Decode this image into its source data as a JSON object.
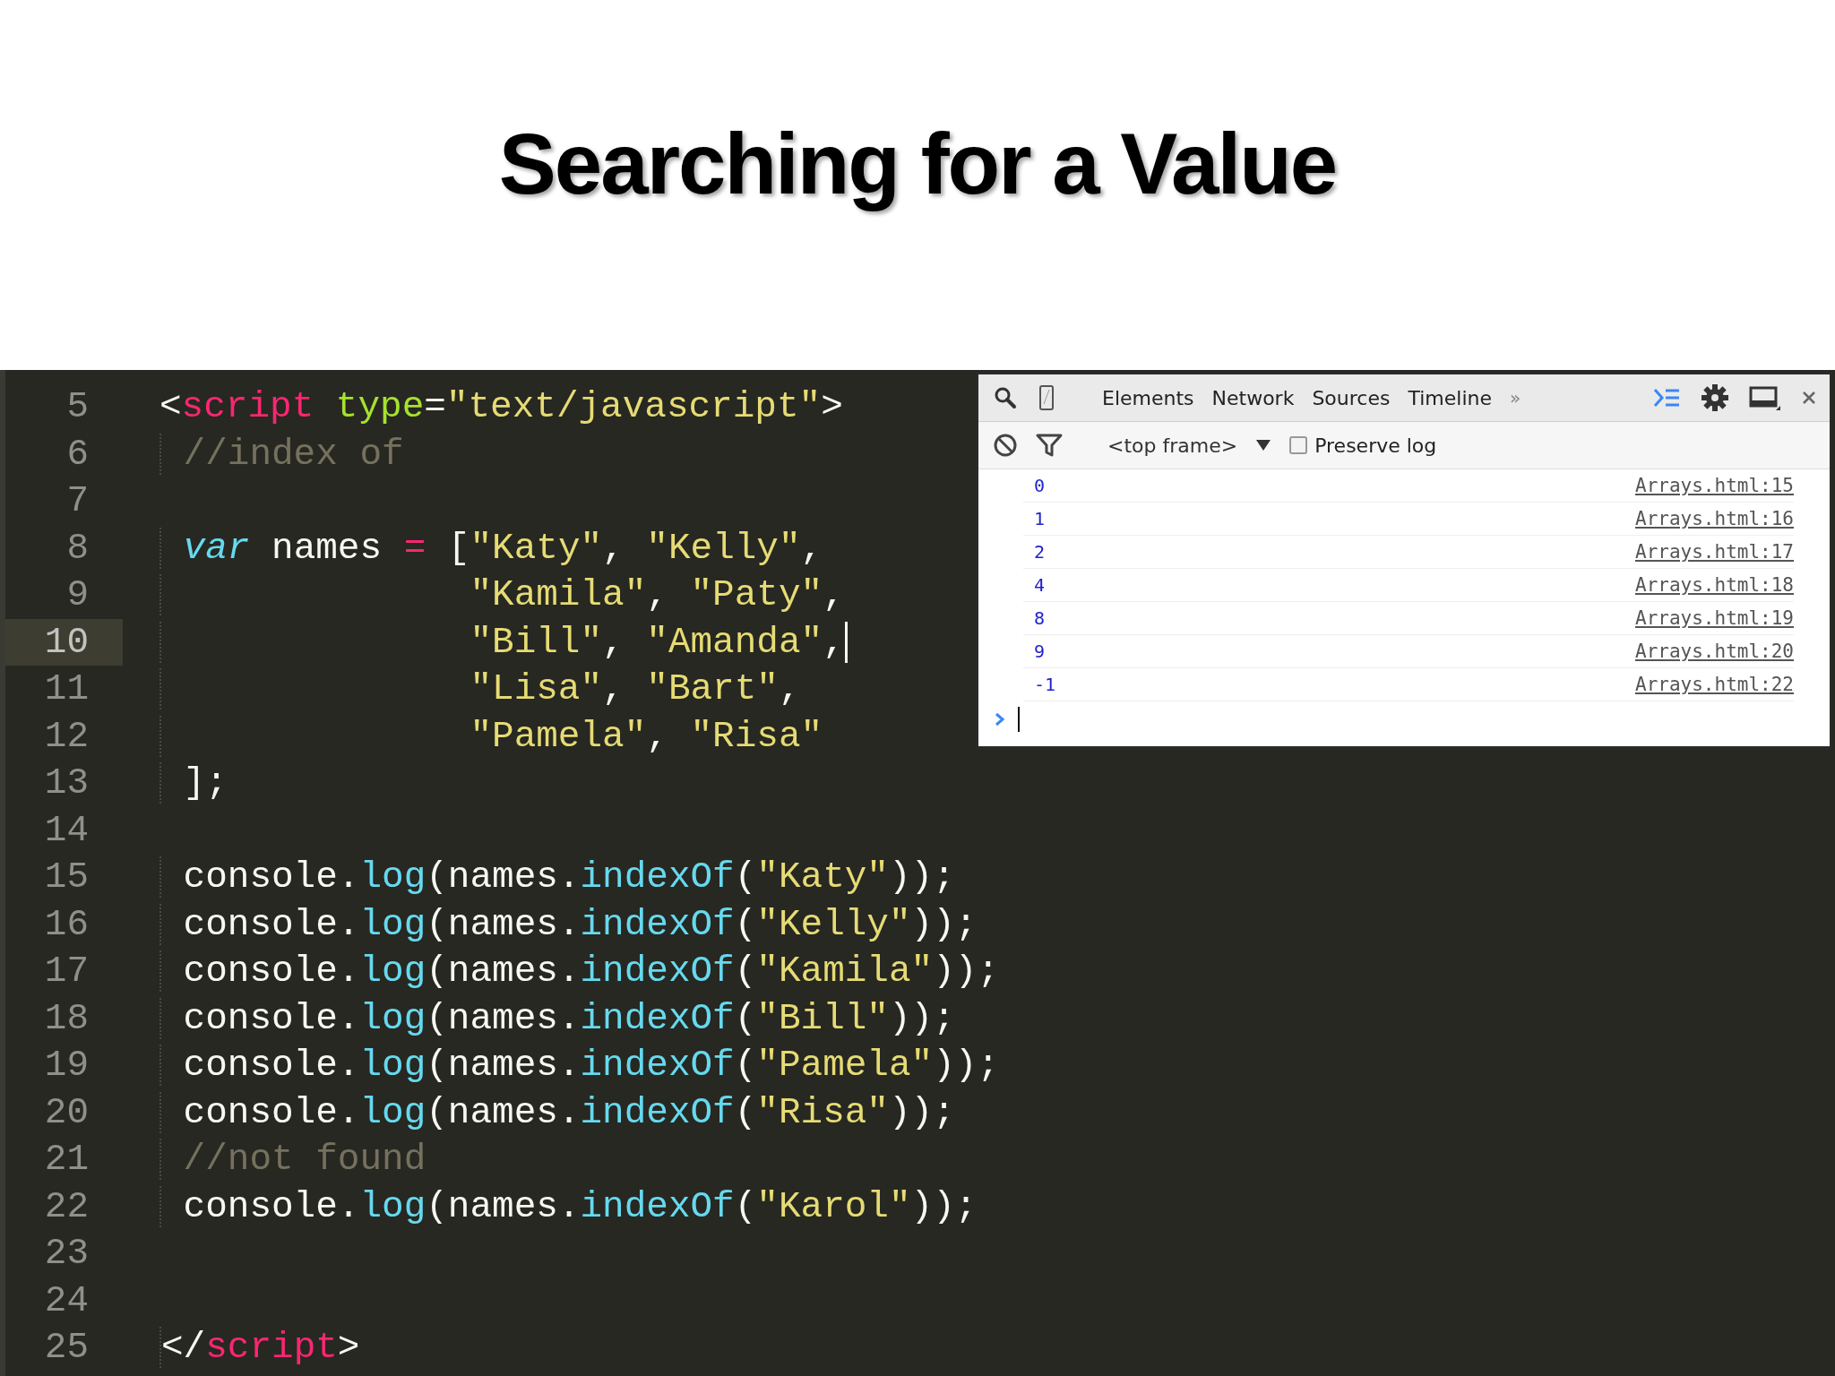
{
  "slide": {
    "title": "Searching for a Value"
  },
  "editor": {
    "lines": [
      {
        "number": "5",
        "current": false,
        "tokens": [
          {
            "kind": "plain",
            "text": "<"
          },
          {
            "kind": "tag",
            "text": "script "
          },
          {
            "kind": "attr",
            "text": "type"
          },
          {
            "kind": "plain",
            "text": "="
          },
          {
            "kind": "string",
            "text": "\"text/javascript\""
          },
          {
            "kind": "plain",
            "text": ">"
          }
        ]
      },
      {
        "number": "6",
        "current": false,
        "tokens": [
          {
            "kind": "comment",
            "text": " //index of"
          }
        ]
      },
      {
        "number": "7",
        "current": false
      },
      {
        "number": "8",
        "current": false,
        "tokens": [
          {
            "kind": "keyword",
            "text": " var"
          },
          {
            "kind": "plain",
            "text": " names "
          },
          {
            "kind": "op",
            "text": "="
          },
          {
            "kind": "plain",
            "text": " ["
          },
          {
            "kind": "string",
            "text": "\"Katy\""
          },
          {
            "kind": "plain",
            "text": ", "
          },
          {
            "kind": "string",
            "text": "\"Kelly\""
          },
          {
            "kind": "plain",
            "text": ","
          }
        ]
      },
      {
        "number": "9",
        "current": false,
        "tokens": [
          {
            "kind": "string",
            "text": "              \"Kamila\""
          },
          {
            "kind": "plain",
            "text": ", "
          },
          {
            "kind": "string",
            "text": "\"Paty\""
          },
          {
            "kind": "plain",
            "text": ","
          }
        ]
      },
      {
        "number": "10",
        "current": true,
        "tokens": [
          {
            "kind": "string",
            "text": "              \"Bill\""
          },
          {
            "kind": "plain",
            "text": ", "
          },
          {
            "kind": "string",
            "text": "\"Amanda\""
          },
          {
            "kind": "plain",
            "text": ","
          }
        ]
      },
      {
        "number": "11",
        "current": false,
        "tokens": [
          {
            "kind": "string",
            "text": "              \"Lisa\""
          },
          {
            "kind": "plain",
            "text": ", "
          },
          {
            "kind": "string",
            "text": "\"Bart\""
          },
          {
            "kind": "plain",
            "text": ","
          }
        ]
      },
      {
        "number": "12",
        "current": false,
        "tokens": [
          {
            "kind": "string",
            "text": "              \"Pamela\""
          },
          {
            "kind": "plain",
            "text": ", "
          },
          {
            "kind": "string",
            "text": "\"Risa\""
          }
        ]
      },
      {
        "number": "13",
        "current": false,
        "tokens": [
          {
            "kind": "plain",
            "text": " ];"
          }
        ]
      },
      {
        "number": "14",
        "current": false
      },
      {
        "number": "15",
        "current": false,
        "tokens": [
          {
            "kind": "plain",
            "text": " console."
          },
          {
            "kind": "method",
            "text": "log"
          },
          {
            "kind": "plain",
            "text": "(names."
          },
          {
            "kind": "method",
            "text": "indexOf"
          },
          {
            "kind": "plain",
            "text": "("
          },
          {
            "kind": "string",
            "text": "\"Katy\""
          },
          {
            "kind": "plain",
            "text": "));"
          }
        ]
      },
      {
        "number": "16",
        "current": false,
        "tokens": [
          {
            "kind": "plain",
            "text": " console."
          },
          {
            "kind": "method",
            "text": "log"
          },
          {
            "kind": "plain",
            "text": "(names."
          },
          {
            "kind": "method",
            "text": "indexOf"
          },
          {
            "kind": "plain",
            "text": "("
          },
          {
            "kind": "string",
            "text": "\"Kelly\""
          },
          {
            "kind": "plain",
            "text": "));"
          }
        ]
      },
      {
        "number": "17",
        "current": false,
        "tokens": [
          {
            "kind": "plain",
            "text": " console."
          },
          {
            "kind": "method",
            "text": "log"
          },
          {
            "kind": "plain",
            "text": "(names."
          },
          {
            "kind": "method",
            "text": "indexOf"
          },
          {
            "kind": "plain",
            "text": "("
          },
          {
            "kind": "string",
            "text": "\"Kamila\""
          },
          {
            "kind": "plain",
            "text": "));"
          }
        ]
      },
      {
        "number": "18",
        "current": false,
        "tokens": [
          {
            "kind": "plain",
            "text": " console."
          },
          {
            "kind": "method",
            "text": "log"
          },
          {
            "kind": "plain",
            "text": "(names."
          },
          {
            "kind": "method",
            "text": "indexOf"
          },
          {
            "kind": "plain",
            "text": "("
          },
          {
            "kind": "string",
            "text": "\"Bill\""
          },
          {
            "kind": "plain",
            "text": "));"
          }
        ]
      },
      {
        "number": "19",
        "current": false,
        "tokens": [
          {
            "kind": "plain",
            "text": " console."
          },
          {
            "kind": "method",
            "text": "log"
          },
          {
            "kind": "plain",
            "text": "(names."
          },
          {
            "kind": "method",
            "text": "indexOf"
          },
          {
            "kind": "plain",
            "text": "("
          },
          {
            "kind": "string",
            "text": "\"Pamela\""
          },
          {
            "kind": "plain",
            "text": "));"
          }
        ]
      },
      {
        "number": "20",
        "current": false,
        "tokens": [
          {
            "kind": "plain",
            "text": " console."
          },
          {
            "kind": "method",
            "text": "log"
          },
          {
            "kind": "plain",
            "text": "(names."
          },
          {
            "kind": "method",
            "text": "indexOf"
          },
          {
            "kind": "plain",
            "text": "("
          },
          {
            "kind": "string",
            "text": "\"Risa\""
          },
          {
            "kind": "plain",
            "text": "));"
          }
        ]
      },
      {
        "number": "21",
        "current": false,
        "tokens": [
          {
            "kind": "comment",
            "text": " //not found"
          }
        ]
      },
      {
        "number": "22",
        "current": false,
        "tokens": [
          {
            "kind": "plain",
            "text": " console."
          },
          {
            "kind": "method",
            "text": "log"
          },
          {
            "kind": "plain",
            "text": "(names."
          },
          {
            "kind": "method",
            "text": "indexOf"
          },
          {
            "kind": "plain",
            "text": "("
          },
          {
            "kind": "string",
            "text": "\"Karol\""
          },
          {
            "kind": "plain",
            "text": "));"
          }
        ]
      },
      {
        "number": "23",
        "current": false
      },
      {
        "number": "24",
        "current": false
      },
      {
        "number": "25",
        "current": false,
        "tokens": [
          {
            "kind": "plain",
            "text": "</"
          },
          {
            "kind": "tag",
            "text": "script"
          },
          {
            "kind": "plain",
            "text": ">"
          }
        ]
      }
    ]
  },
  "devtools": {
    "tabs": [
      "Elements",
      "Network",
      "Sources",
      "Timeline"
    ],
    "more": "»",
    "frame_selector": "<top frame>",
    "preserve_log": {
      "label": "Preserve log",
      "checked": false
    },
    "rows": [
      {
        "value": "0",
        "source": "Arrays.html:15"
      },
      {
        "value": "1",
        "source": "Arrays.html:16"
      },
      {
        "value": "2",
        "source": "Arrays.html:17"
      },
      {
        "value": "4",
        "source": "Arrays.html:18"
      },
      {
        "value": "8",
        "source": "Arrays.html:19"
      },
      {
        "value": "9",
        "source": "Arrays.html:20"
      },
      {
        "value": "-1",
        "source": "Arrays.html:22"
      }
    ]
  }
}
